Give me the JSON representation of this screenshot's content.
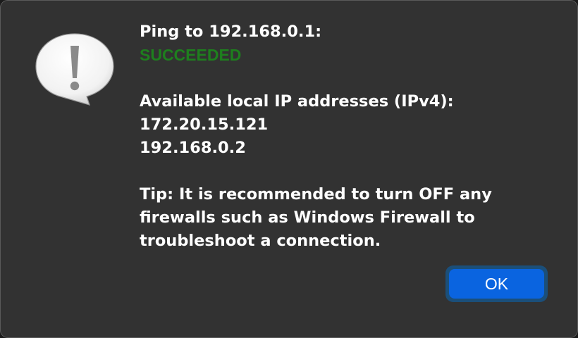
{
  "dialog": {
    "icon": "exclamation-speech-bubble-icon",
    "ping_line": "Ping to 192.168.0.1:",
    "ping_status": "SUCCEEDED",
    "ip_heading": "Available local IP addresses (IPv4):",
    "ip_addresses": [
      "172.20.15.121",
      "192.168.0.2"
    ],
    "tip_lines": [
      "Tip: It is recommended to turn OFF any",
      "firewalls such as Windows Firewall to",
      "troubleshoot a connection."
    ],
    "ok_label": "OK"
  },
  "colors": {
    "dialog_background": "#323232",
    "status_success": "#1e7f1e",
    "button_accent": "#0a64e0"
  }
}
